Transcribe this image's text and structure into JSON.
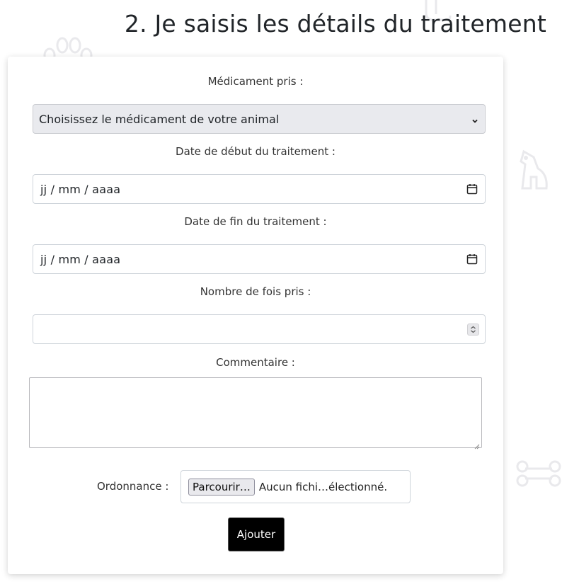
{
  "header": {
    "title": "2. Je saisis les détails du traitement"
  },
  "form": {
    "medication_label": "Médicament pris :",
    "medication_selected": "Choisissez le médicament de votre animal",
    "start_date_label": "Date de début du traitement :",
    "start_date_value": "jj / mm / aaaa",
    "end_date_label": "Date de fin du traitement :",
    "end_date_value": "jj / mm / aaaa",
    "count_label": "Nombre de fois pris :",
    "count_value": "",
    "comment_label": "Commentaire :",
    "comment_value": "",
    "prescription_label": "Ordonnance :",
    "file_button_label": "Parcourir…",
    "file_status": "Aucun fichi…électionné.",
    "submit_label": "Ajouter"
  },
  "icons": {
    "select_caret": "chevron-down-icon",
    "date_picker": "calendar-icon",
    "number_spinner": "spinner-icon",
    "decorations": [
      "paw-icon",
      "dog-icon",
      "bone-icon"
    ]
  },
  "colors": {
    "submit_background": "#000000",
    "select_background": "#e9eaee",
    "decoration": "#e9e9ec"
  }
}
